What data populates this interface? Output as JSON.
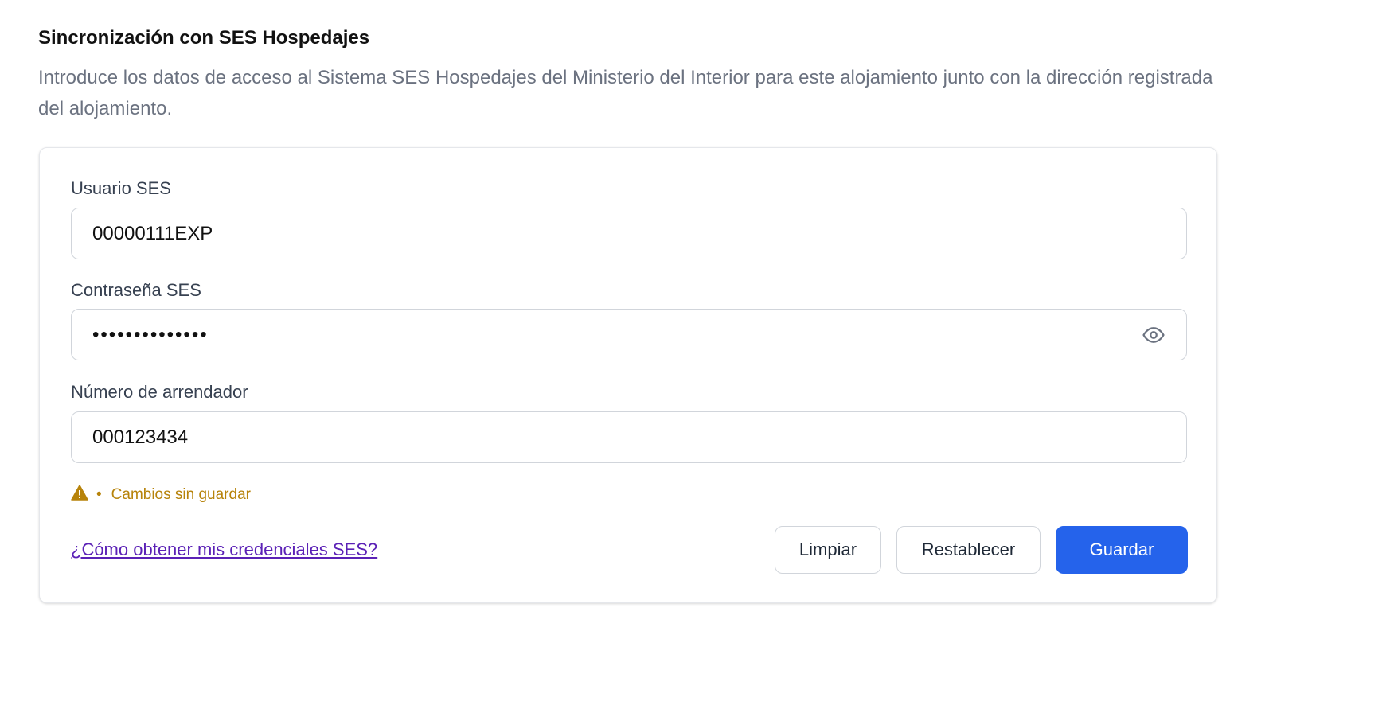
{
  "section": {
    "title": "Sincronización con SES Hospedajes",
    "description": "Introduce los datos de acceso al Sistema SES Hospedajes del Ministerio del Interior para este alojamiento junto con la dirección registrada del alojamiento."
  },
  "form": {
    "username": {
      "label": "Usuario SES",
      "value": "00000111EXP"
    },
    "password": {
      "label": "Contraseña SES",
      "masked_value": "••••••••••••••",
      "toggle_icon": "eye-icon"
    },
    "landlord_number": {
      "label": "Número de arrendador",
      "value": "000123434"
    }
  },
  "status": {
    "icon": "warning-triangle-icon",
    "separator": "•",
    "text": "Cambios sin guardar",
    "color": "#b7830a"
  },
  "help_link": {
    "text": "¿Cómo obtener mis credenciales SES?"
  },
  "actions": {
    "clear_label": "Limpiar",
    "reset_label": "Restablecer",
    "save_label": "Guardar"
  },
  "colors": {
    "primary": "#2563eb",
    "link": "#5b21b6",
    "muted_text": "#6b7280",
    "warning": "#b7830a"
  }
}
